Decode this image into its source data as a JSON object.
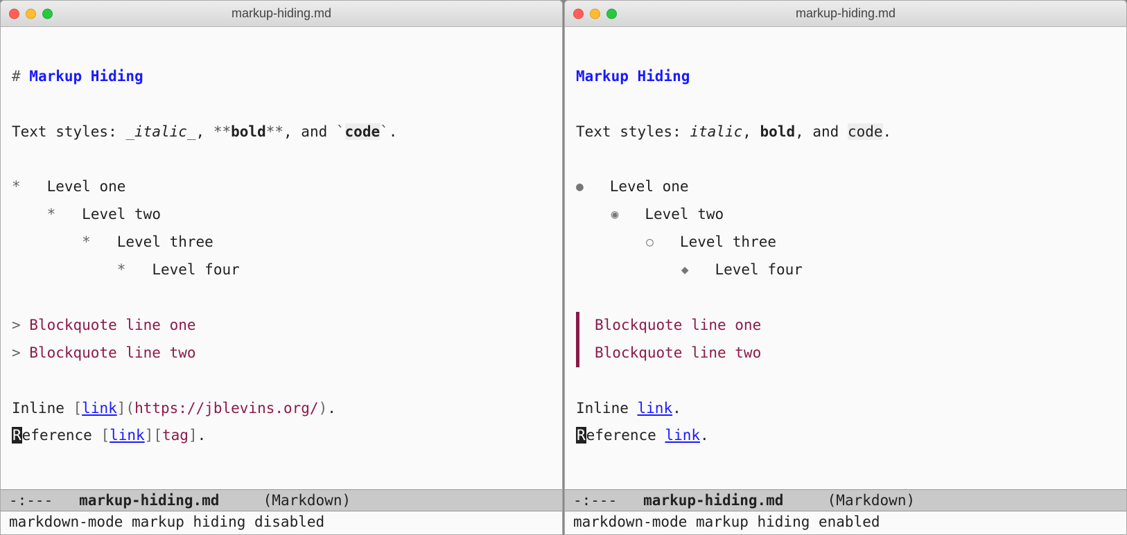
{
  "left": {
    "title": "markup-hiding.md",
    "heading_marker": "# ",
    "heading": "Markup Hiding",
    "styles_prefix": "Text styles: ",
    "italic_open": "_",
    "italic": "italic",
    "italic_close": "_",
    "sep1": ", ",
    "bold_open": "**",
    "bold": "bold",
    "bold_close": "**",
    "sep2": ", and ",
    "code_open": "`",
    "code": "code",
    "code_close": "`",
    "styles_end": ".",
    "list": [
      {
        "indent": "",
        "bullet": "*",
        "gap": "   ",
        "text": "Level one"
      },
      {
        "indent": "    ",
        "bullet": "*",
        "gap": "   ",
        "text": "Level two"
      },
      {
        "indent": "        ",
        "bullet": "*",
        "gap": "   ",
        "text": "Level three"
      },
      {
        "indent": "            ",
        "bullet": "*",
        "gap": "   ",
        "text": "Level four"
      }
    ],
    "bq_marker": "> ",
    "bq1": "Blockquote line one",
    "bq2": "Blockquote line two",
    "inline_prefix": "Inline ",
    "lbracket": "[",
    "link_text": "link",
    "rbracket": "]",
    "lparen": "(",
    "url": "https://jblevins.org/",
    "rparen": ")",
    "dot": ".",
    "ref_R": "R",
    "ref_rest": "eference ",
    "ref_tag": "tag",
    "modeline_prefix": "-:---   ",
    "modeline_file": "markup-hiding.md",
    "modeline_mode": "     (Markdown)",
    "minibuffer": "markdown-mode markup hiding disabled"
  },
  "right": {
    "title": "markup-hiding.md",
    "heading": "Markup Hiding",
    "styles_prefix": "Text styles: ",
    "italic": "italic",
    "sep1": ", ",
    "bold": "bold",
    "sep2": ", and ",
    "code": "code",
    "styles_end": ".",
    "list": [
      {
        "indent": "",
        "bullet": "●",
        "gap": "   ",
        "text": "Level one"
      },
      {
        "indent": "    ",
        "bullet": "◉",
        "gap": "   ",
        "text": "Level two"
      },
      {
        "indent": "        ",
        "bullet": "○",
        "gap": "   ",
        "text": "Level three"
      },
      {
        "indent": "            ",
        "bullet": "◆",
        "gap": "   ",
        "text": "Level four"
      }
    ],
    "bq1": "Blockquote line one",
    "bq2": "Blockquote line two",
    "inline_prefix": "Inline ",
    "link_text": "link",
    "dot": ".",
    "ref_R": "R",
    "ref_rest": "eference ",
    "modeline_prefix": "-:---   ",
    "modeline_file": "markup-hiding.md",
    "modeline_mode": "     (Markdown)",
    "minibuffer": "markdown-mode markup hiding enabled"
  }
}
